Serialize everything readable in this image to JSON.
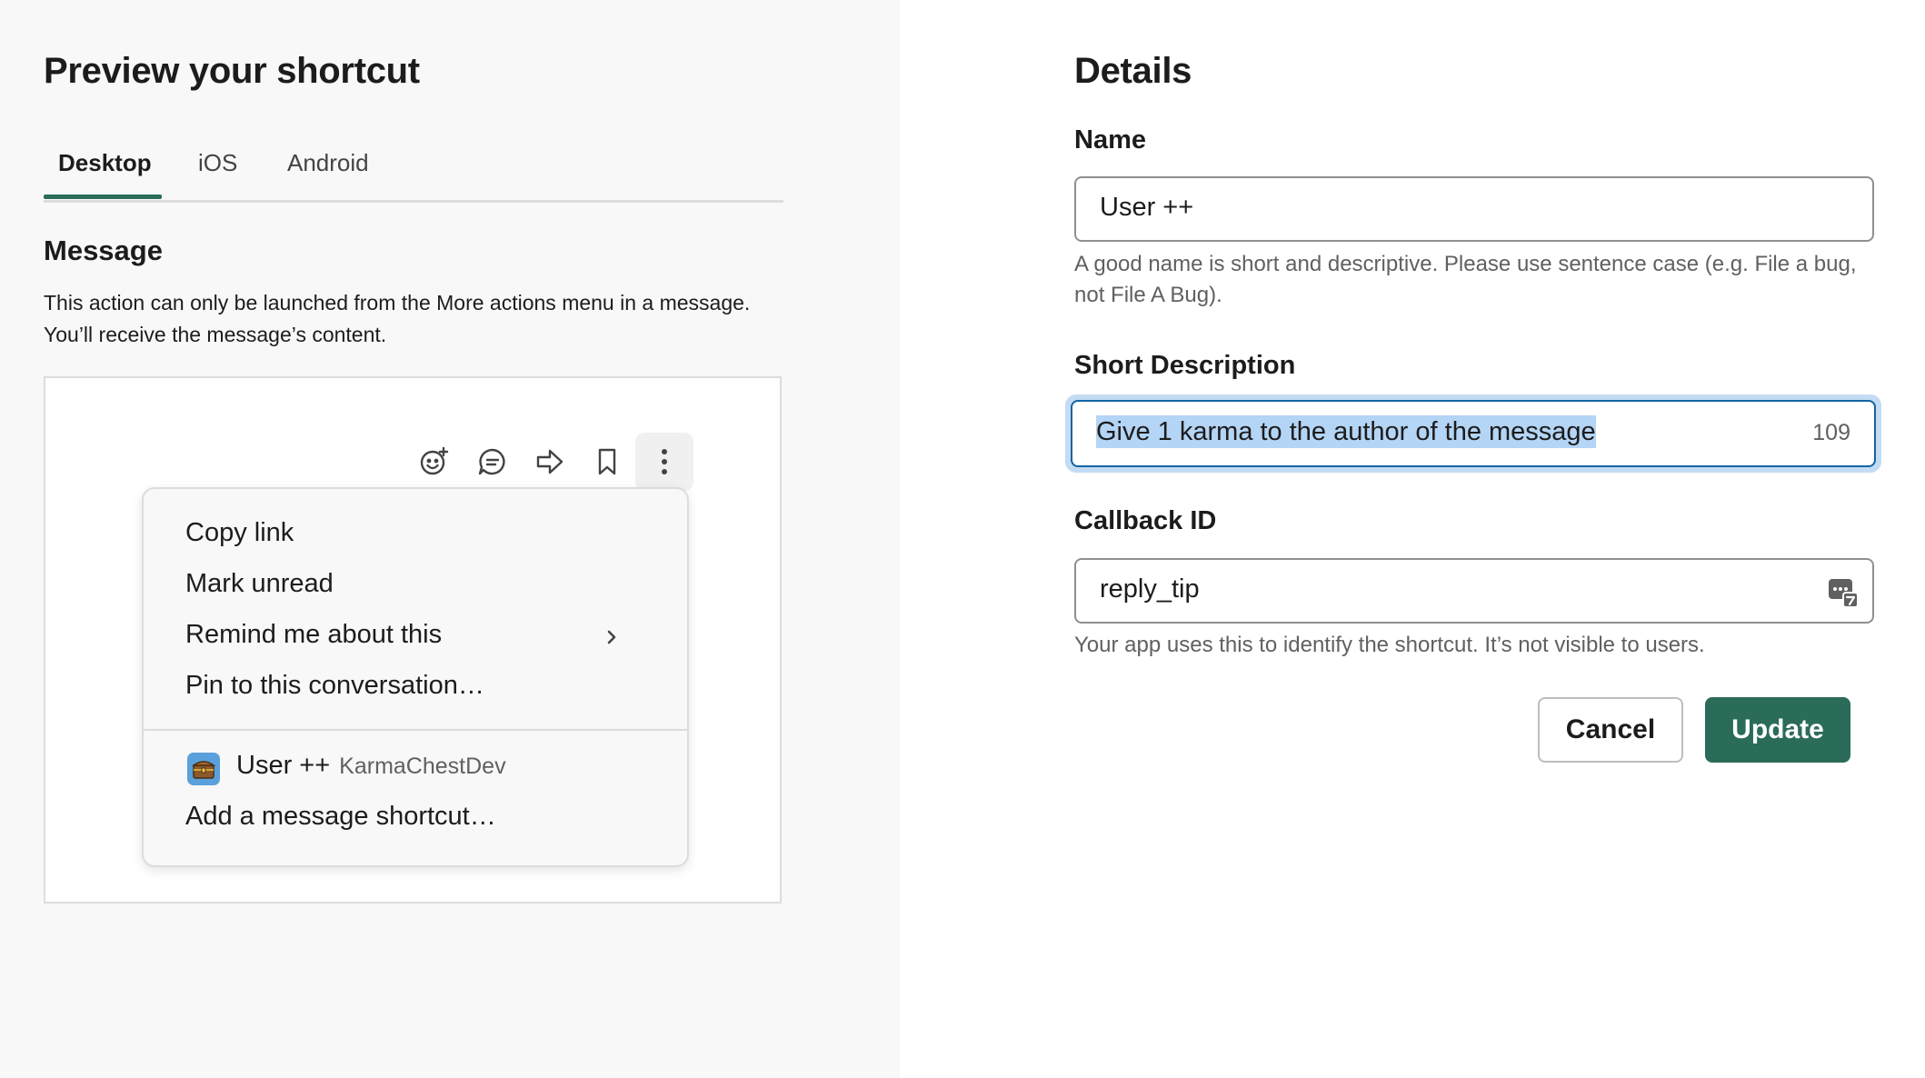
{
  "preview": {
    "title": "Preview your shortcut",
    "tabs": [
      {
        "label": "Desktop",
        "active": true
      },
      {
        "label": "iOS",
        "active": false
      },
      {
        "label": "Android",
        "active": false
      }
    ],
    "section_title": "Message",
    "description_line1": "This action can only be launched from the More actions menu in a message.",
    "description_line2": "You’ll receive the message’s content.",
    "toolbar_icons": [
      "add-reaction-icon",
      "reply-in-thread-icon",
      "share-icon",
      "bookmark-icon",
      "more-actions-icon"
    ],
    "menu": {
      "items": [
        "Copy link",
        "Mark unread",
        "Remind me about this",
        "Pin to this conversation…"
      ],
      "app_shortcut_name": "User ++",
      "app_developer": "KarmaChestDev",
      "add_shortcut": "Add a message shortcut…"
    }
  },
  "details": {
    "title": "Details",
    "name_label": "Name",
    "name_value": "User ++",
    "name_hint": "A good name is short and descriptive. Please use sentence case (e.g. File a bug, not File A Bug).",
    "short_desc_label": "Short Description",
    "short_desc_value": "Give 1 karma to the author of the message",
    "short_desc_counter": "109",
    "callback_label": "Callback ID",
    "callback_value": "reply_tip",
    "callback_hint": "Your app uses this to identify the shortcut. It’s not visible to users.",
    "cancel_label": "Cancel",
    "update_label": "Update"
  },
  "colors": {
    "accent_green": "#2b6b59",
    "focus_blue": "#1264a3",
    "selection_blue": "#b4d5f5"
  }
}
